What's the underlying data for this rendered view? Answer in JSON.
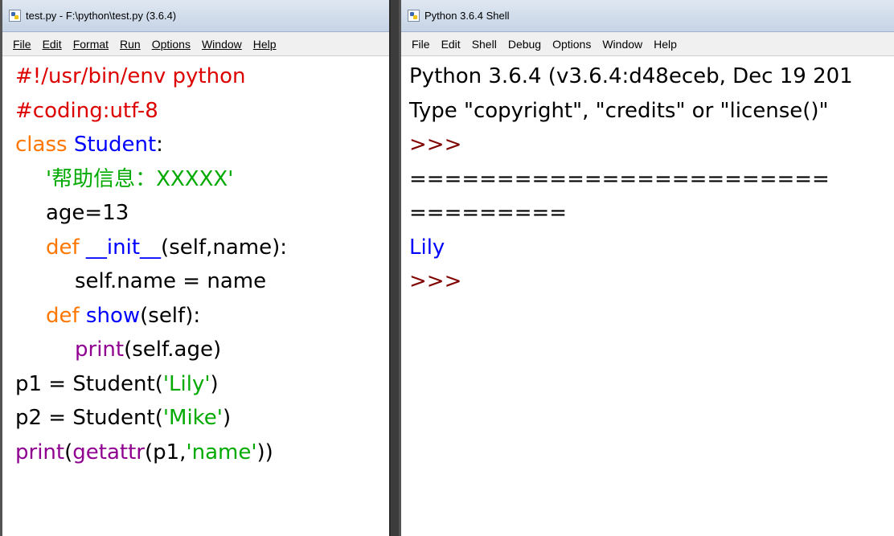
{
  "editor": {
    "title": "test.py - F:\\python\\test.py (3.6.4)",
    "menu": [
      "File",
      "Edit",
      "Format",
      "Run",
      "Options",
      "Window",
      "Help"
    ],
    "lines": [
      {
        "indent": 0,
        "tokens": [
          {
            "t": "#!/usr/bin/env python",
            "c": "comment"
          }
        ]
      },
      {
        "indent": 0,
        "tokens": [
          {
            "t": "#coding:utf-8",
            "c": "comment"
          }
        ]
      },
      {
        "indent": 0,
        "tokens": [
          {
            "t": "class",
            "c": "kw"
          },
          {
            "t": " ",
            "c": "plain"
          },
          {
            "t": "Student",
            "c": "def"
          },
          {
            "t": ":",
            "c": "plain"
          }
        ]
      },
      {
        "indent": 1,
        "tokens": [
          {
            "t": "'帮助信息：XXXXX'",
            "c": "str"
          }
        ]
      },
      {
        "indent": 1,
        "tokens": [
          {
            "t": "age=13",
            "c": "plain"
          }
        ]
      },
      {
        "indent": 1,
        "tokens": [
          {
            "t": "def",
            "c": "kw"
          },
          {
            "t": " ",
            "c": "plain"
          },
          {
            "t": "__init__",
            "c": "def"
          },
          {
            "t": "(self,name):",
            "c": "plain"
          }
        ]
      },
      {
        "indent": 2,
        "tokens": [
          {
            "t": "self.name = name",
            "c": "plain"
          }
        ]
      },
      {
        "indent": 1,
        "tokens": [
          {
            "t": "def",
            "c": "kw"
          },
          {
            "t": " ",
            "c": "plain"
          },
          {
            "t": "show",
            "c": "def"
          },
          {
            "t": "(self):",
            "c": "plain"
          }
        ]
      },
      {
        "indent": 2,
        "tokens": [
          {
            "t": "print",
            "c": "builtin"
          },
          {
            "t": "(self.age)",
            "c": "plain"
          }
        ]
      },
      {
        "indent": 0,
        "tokens": [
          {
            "t": "p1 = Student(",
            "c": "plain"
          },
          {
            "t": "'Lily'",
            "c": "str"
          },
          {
            "t": ")",
            "c": "plain"
          }
        ]
      },
      {
        "indent": 0,
        "tokens": [
          {
            "t": "p2 = Student(",
            "c": "plain"
          },
          {
            "t": "'Mike'",
            "c": "str"
          },
          {
            "t": ")",
            "c": "plain"
          }
        ]
      },
      {
        "indent": 0,
        "tokens": [
          {
            "t": "print",
            "c": "builtin"
          },
          {
            "t": "(",
            "c": "plain"
          },
          {
            "t": "getattr",
            "c": "builtin"
          },
          {
            "t": "(p1,",
            "c": "plain"
          },
          {
            "t": "'name'",
            "c": "str"
          },
          {
            "t": "))",
            "c": "plain"
          }
        ]
      }
    ]
  },
  "shell": {
    "title": "Python 3.6.4 Shell",
    "menu": [
      "File",
      "Edit",
      "Shell",
      "Debug",
      "Options",
      "Window",
      "Help"
    ],
    "lines": [
      {
        "tokens": [
          {
            "t": "Python 3.6.4 (v3.6.4:d48eceb, Dec 19 201",
            "c": "out"
          }
        ]
      },
      {
        "tokens": [
          {
            "t": "Type \"copyright\", \"credits\" or \"license()\"",
            "c": "out"
          }
        ]
      },
      {
        "tokens": [
          {
            "t": ">>>",
            "c": "prompt"
          }
        ]
      },
      {
        "tokens": [
          {
            "t": "========================",
            "c": "out"
          }
        ]
      },
      {
        "tokens": [
          {
            "t": "=========",
            "c": "out"
          }
        ]
      },
      {
        "tokens": [
          {
            "t": "Lily",
            "c": "stdout"
          }
        ]
      },
      {
        "tokens": [
          {
            "t": ">>>",
            "c": "prompt"
          }
        ]
      }
    ]
  }
}
